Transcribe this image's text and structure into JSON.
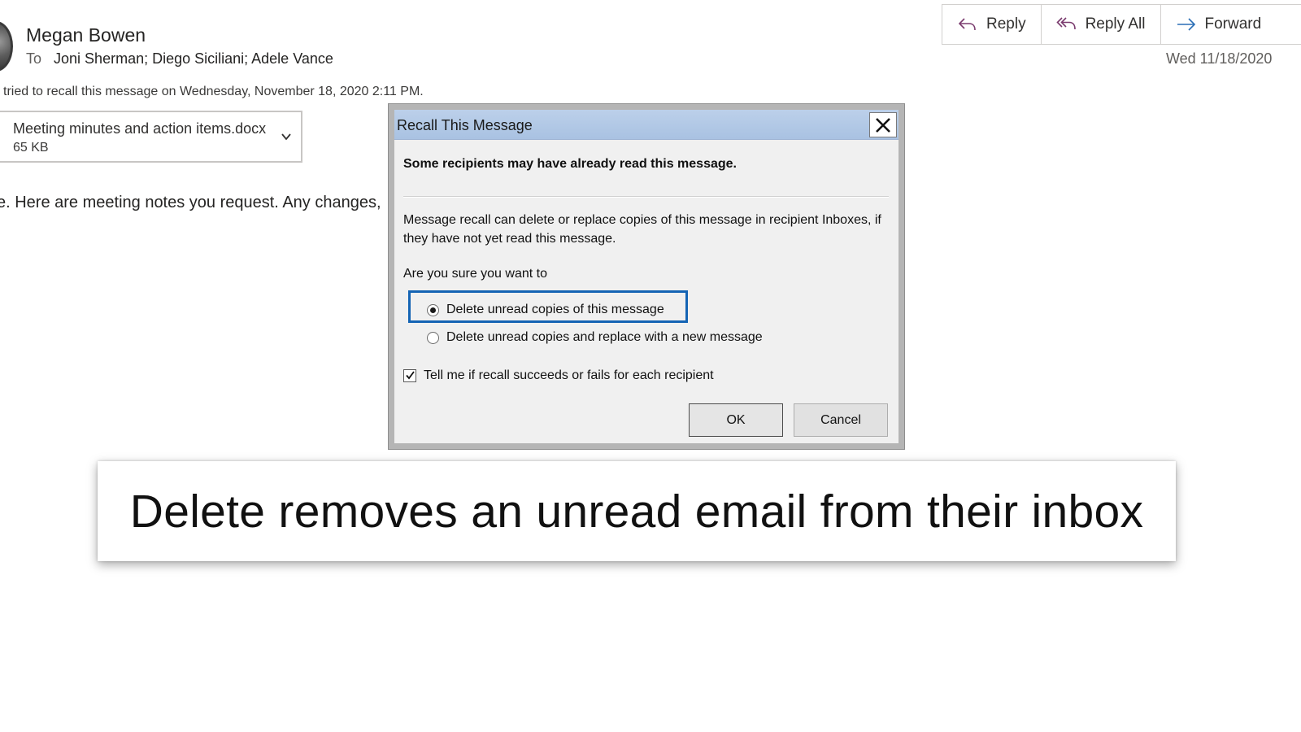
{
  "email": {
    "sender": "Megan Bowen",
    "to_label": "To",
    "recipients": "Joni Sherman; Diego Siciliani; Adele Vance",
    "recall_info": "tried to recall this message on Wednesday, November 18, 2020 2:11 PM.",
    "attachment": {
      "name": "Meeting minutes and action items.docx",
      "size": "65 KB"
    },
    "body": "e. Here are meeting notes you request. Any changes,",
    "date": "Wed 11/18/2020"
  },
  "toolbar": {
    "reply_label": "Reply",
    "reply_all_label": "Reply All",
    "forward_label": "Forward"
  },
  "dialog": {
    "title": "Recall This Message",
    "warning": "Some recipients may have already read this message.",
    "description": "Message recall can delete or replace copies of this message in recipient Inboxes, if they have not yet read this message.",
    "question": "Are you sure you want to",
    "options": [
      {
        "label": "Delete unread copies of this message",
        "selected": true
      },
      {
        "label": "Delete unread copies and replace with a new message",
        "selected": false
      }
    ],
    "notify_label": "Tell me if recall succeeds or fails for each recipient",
    "notify_checked": true,
    "ok_label": "OK",
    "cancel_label": "Cancel"
  },
  "caption": {
    "text": "Delete removes an unread email from their inbox"
  },
  "colors": {
    "accent_icon": "#7a3b6e",
    "forward_icon": "#2b6fb6",
    "focus_border": "#1464b4",
    "titlebar": "#b3c9e6"
  }
}
